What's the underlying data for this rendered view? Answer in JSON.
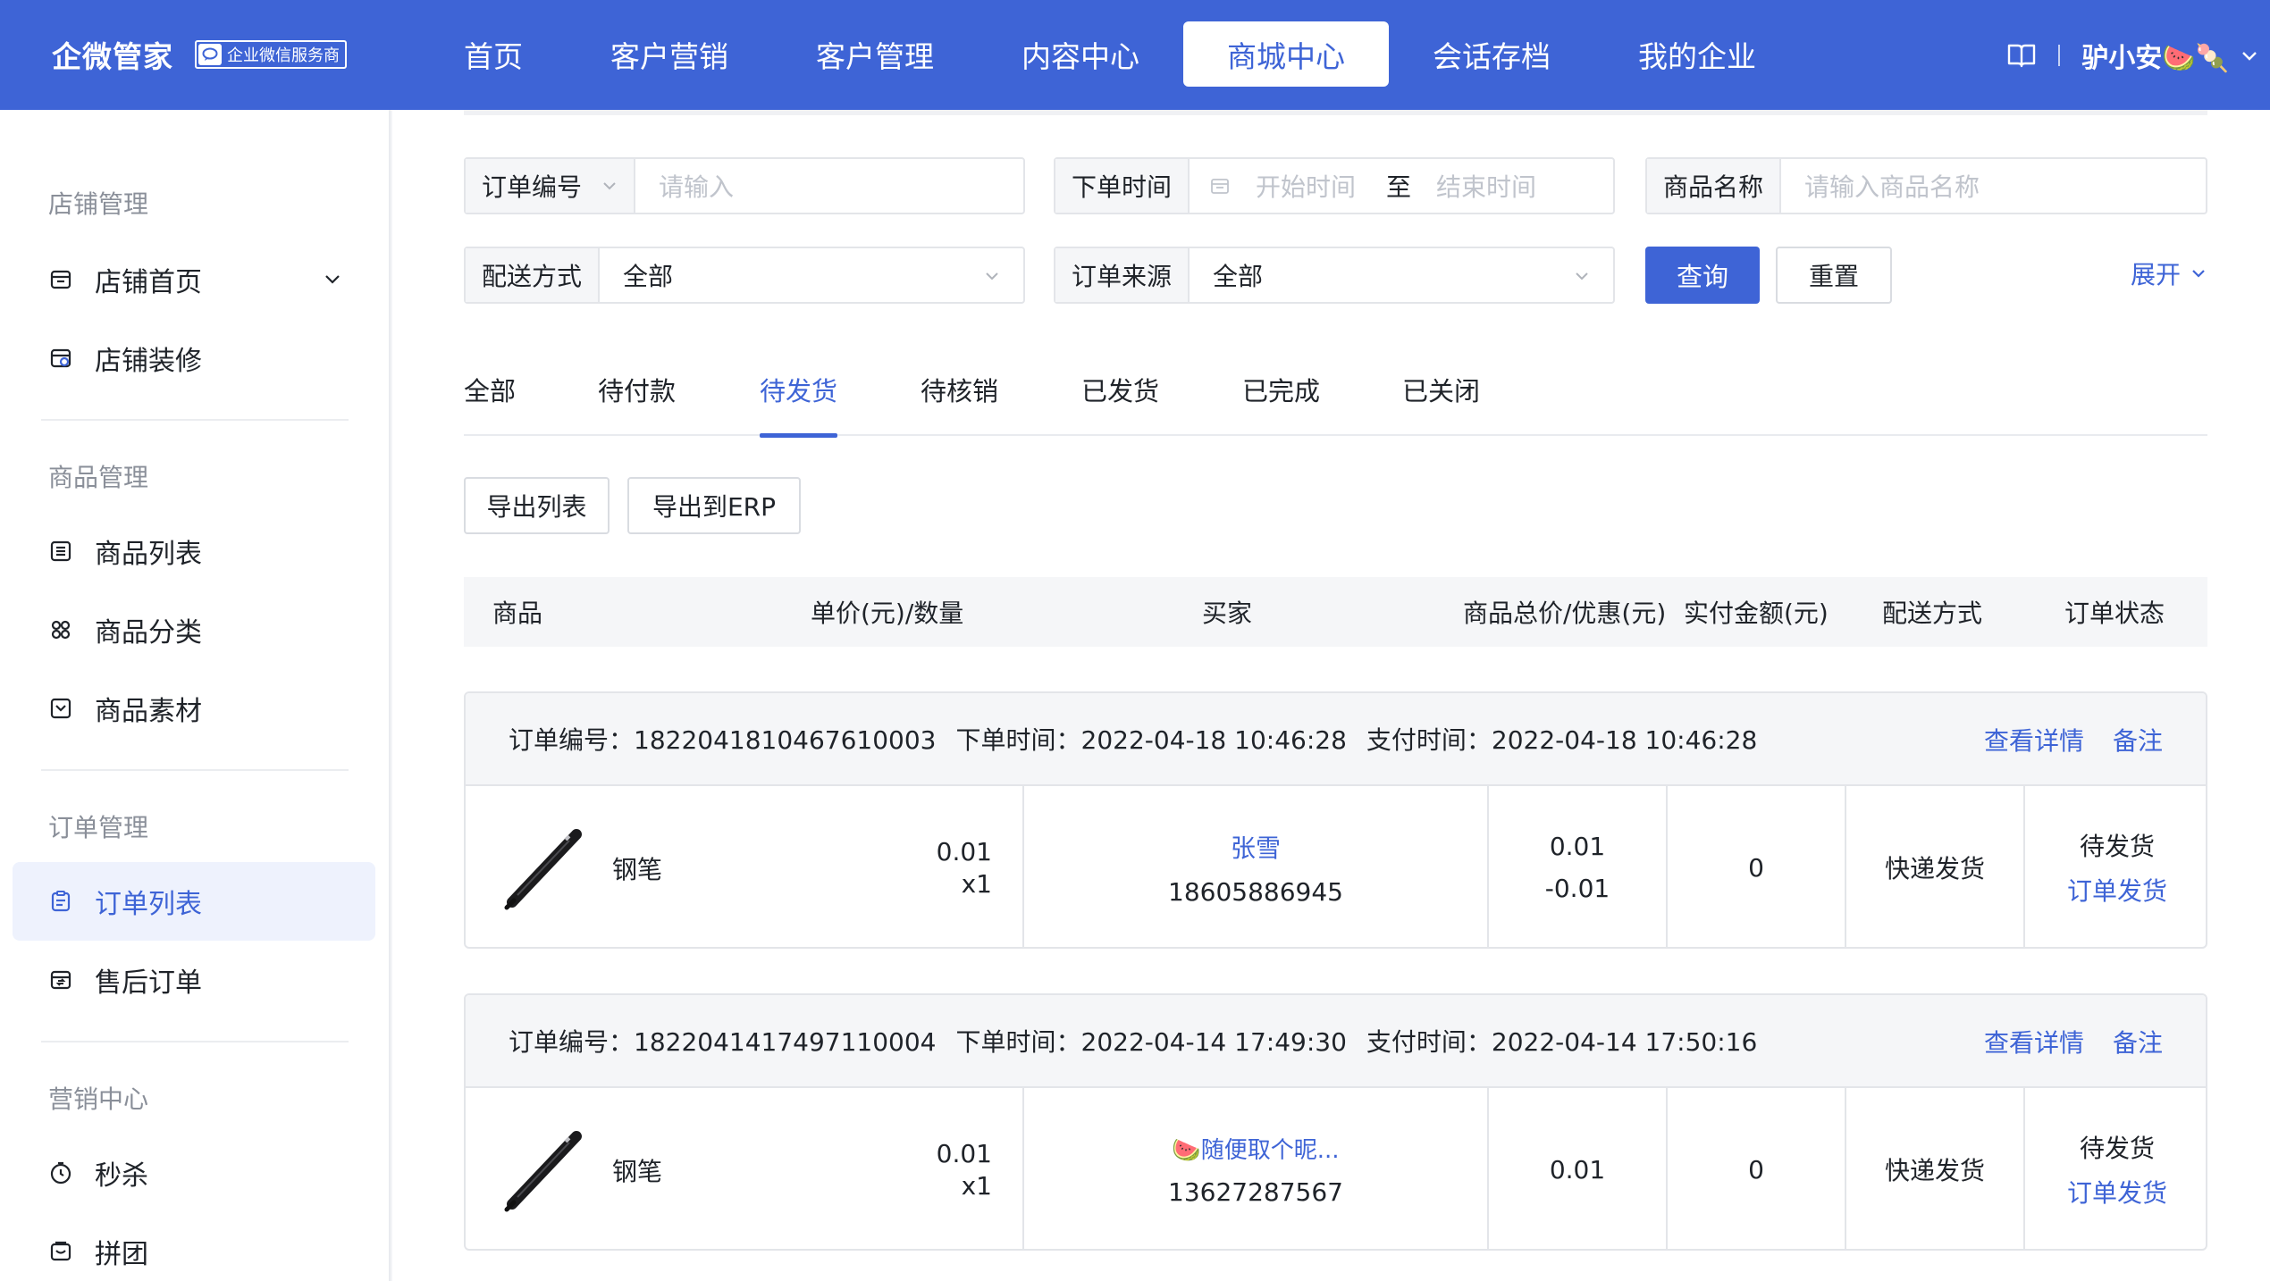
{
  "header": {
    "brand": "企微管家",
    "badge": "企业微信服务商",
    "nav": [
      {
        "label": "首页",
        "active": false
      },
      {
        "label": "客户营销",
        "active": false
      },
      {
        "label": "客户管理",
        "active": false
      },
      {
        "label": "内容中心",
        "active": false
      },
      {
        "label": "商城中心",
        "active": true
      },
      {
        "label": "会话存档",
        "active": false
      },
      {
        "label": "我的企业",
        "active": false
      }
    ],
    "user": "驴小安🍉🍡"
  },
  "sidebar": {
    "groups": [
      {
        "title": "店铺管理",
        "items": [
          {
            "label": "店铺首页",
            "icon": "store-icon"
          },
          {
            "label": "店铺装修",
            "icon": "decorate-icon"
          }
        ]
      },
      {
        "title": "商品管理",
        "items": [
          {
            "label": "商品列表",
            "icon": "list-icon"
          },
          {
            "label": "商品分类",
            "icon": "category-icon"
          },
          {
            "label": "商品素材",
            "icon": "material-icon"
          }
        ]
      },
      {
        "title": "订单管理",
        "items": [
          {
            "label": "订单列表",
            "icon": "order-icon"
          },
          {
            "label": "售后订单",
            "icon": "aftersale-icon"
          }
        ]
      },
      {
        "title": "营销中心",
        "items": [
          {
            "label": "秒杀",
            "icon": "timer-icon"
          },
          {
            "label": "拼团",
            "icon": "group-buy-icon"
          }
        ]
      }
    ],
    "active_item": "订单列表"
  },
  "filters": {
    "order_no": {
      "label": "订单编号",
      "placeholder": "请输入"
    },
    "order_time": {
      "label": "下单时间",
      "start": "开始时间",
      "to": "至",
      "end": "结束时间"
    },
    "product_name": {
      "label": "商品名称",
      "placeholder": "请输入商品名称"
    },
    "delivery": {
      "label": "配送方式",
      "value": "全部"
    },
    "source": {
      "label": "订单来源",
      "value": "全部"
    },
    "query": "查询",
    "reset": "重置",
    "expand": "展开"
  },
  "tabs": [
    {
      "label": "全部",
      "active": false
    },
    {
      "label": "待付款",
      "active": false
    },
    {
      "label": "待发货",
      "active": true
    },
    {
      "label": "待核销",
      "active": false
    },
    {
      "label": "已发货",
      "active": false
    },
    {
      "label": "已完成",
      "active": false
    },
    {
      "label": "已关闭",
      "active": false
    }
  ],
  "actions": {
    "export_list": "导出列表",
    "export_erp": "导出到ERP"
  },
  "table": {
    "columns": [
      "商品",
      "单价(元)/数量",
      "买家",
      "商品总价/优惠(元)",
      "实付金额(元)",
      "配送方式",
      "订单状态"
    ]
  },
  "orders": [
    {
      "order_no_label": "订单编号：",
      "order_no": "1822041810467610003",
      "order_time_label": "下单时间：",
      "order_time": "2022-04-18 10:46:28",
      "pay_time_label": "支付时间：",
      "pay_time": "2022-04-18 10:46:28",
      "detail": "查看详情",
      "remark": "备注",
      "product": "钢笔",
      "price": "0.01",
      "qty": "x1",
      "buyer": "张雪",
      "phone": "18605886945",
      "total": "0.01",
      "discount": "-0.01",
      "paid": "0",
      "delivery": "快递发货",
      "status": "待发货",
      "ship_action": "订单发货"
    },
    {
      "order_no_label": "订单编号：",
      "order_no": "1822041417497110004",
      "order_time_label": "下单时间：",
      "order_time": "2022-04-14 17:49:30",
      "pay_time_label": "支付时间：",
      "pay_time": "2022-04-14 17:50:16",
      "detail": "查看详情",
      "remark": "备注",
      "product": "钢笔",
      "price": "0.01",
      "qty": "x1",
      "buyer": "🍉随便取个昵...",
      "phone": "13627287567",
      "total": "0.01",
      "discount": "",
      "paid": "0",
      "delivery": "快递发货",
      "status": "待发货",
      "ship_action": "订单发货"
    }
  ],
  "colors": {
    "primary": "#3e64d6",
    "header_bg": "#3e64d6",
    "active_bg": "#eef2fd"
  }
}
